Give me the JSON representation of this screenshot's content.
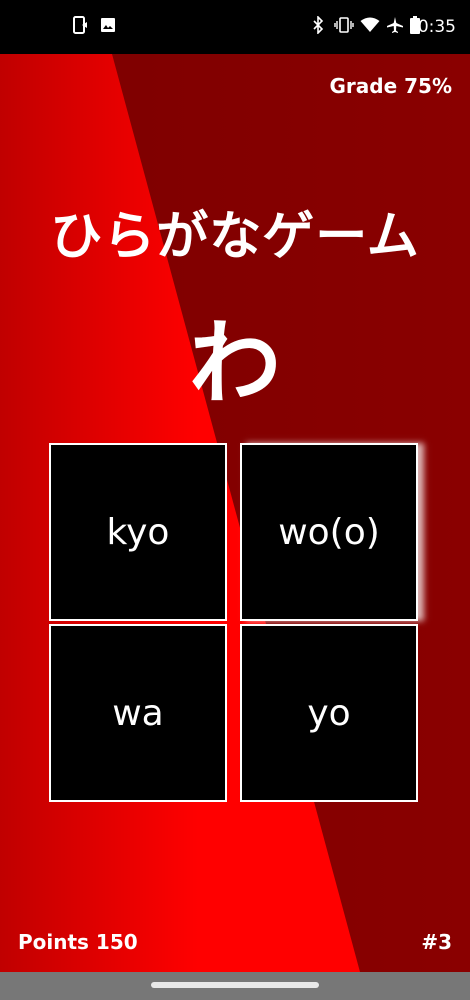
{
  "status_bar": {
    "time": "0:35",
    "left_icons": [
      "phone-sync-icon",
      "image-icon"
    ],
    "right_icons": [
      "bluetooth-icon",
      "vibrate-icon",
      "wifi-icon",
      "airplane-icon",
      "battery-icon"
    ]
  },
  "game": {
    "grade": "Grade 75%",
    "title": "ひらがなゲーム",
    "kana": "わ",
    "choices": [
      "kyo",
      "wo(o)",
      "wa",
      "yo"
    ],
    "points": "Points 150",
    "round": "#3"
  },
  "colors": {
    "background_dark_red": "#7c0000",
    "background_bright_red": "#ff0000",
    "tile": "#000000",
    "text": "#ffffff"
  }
}
